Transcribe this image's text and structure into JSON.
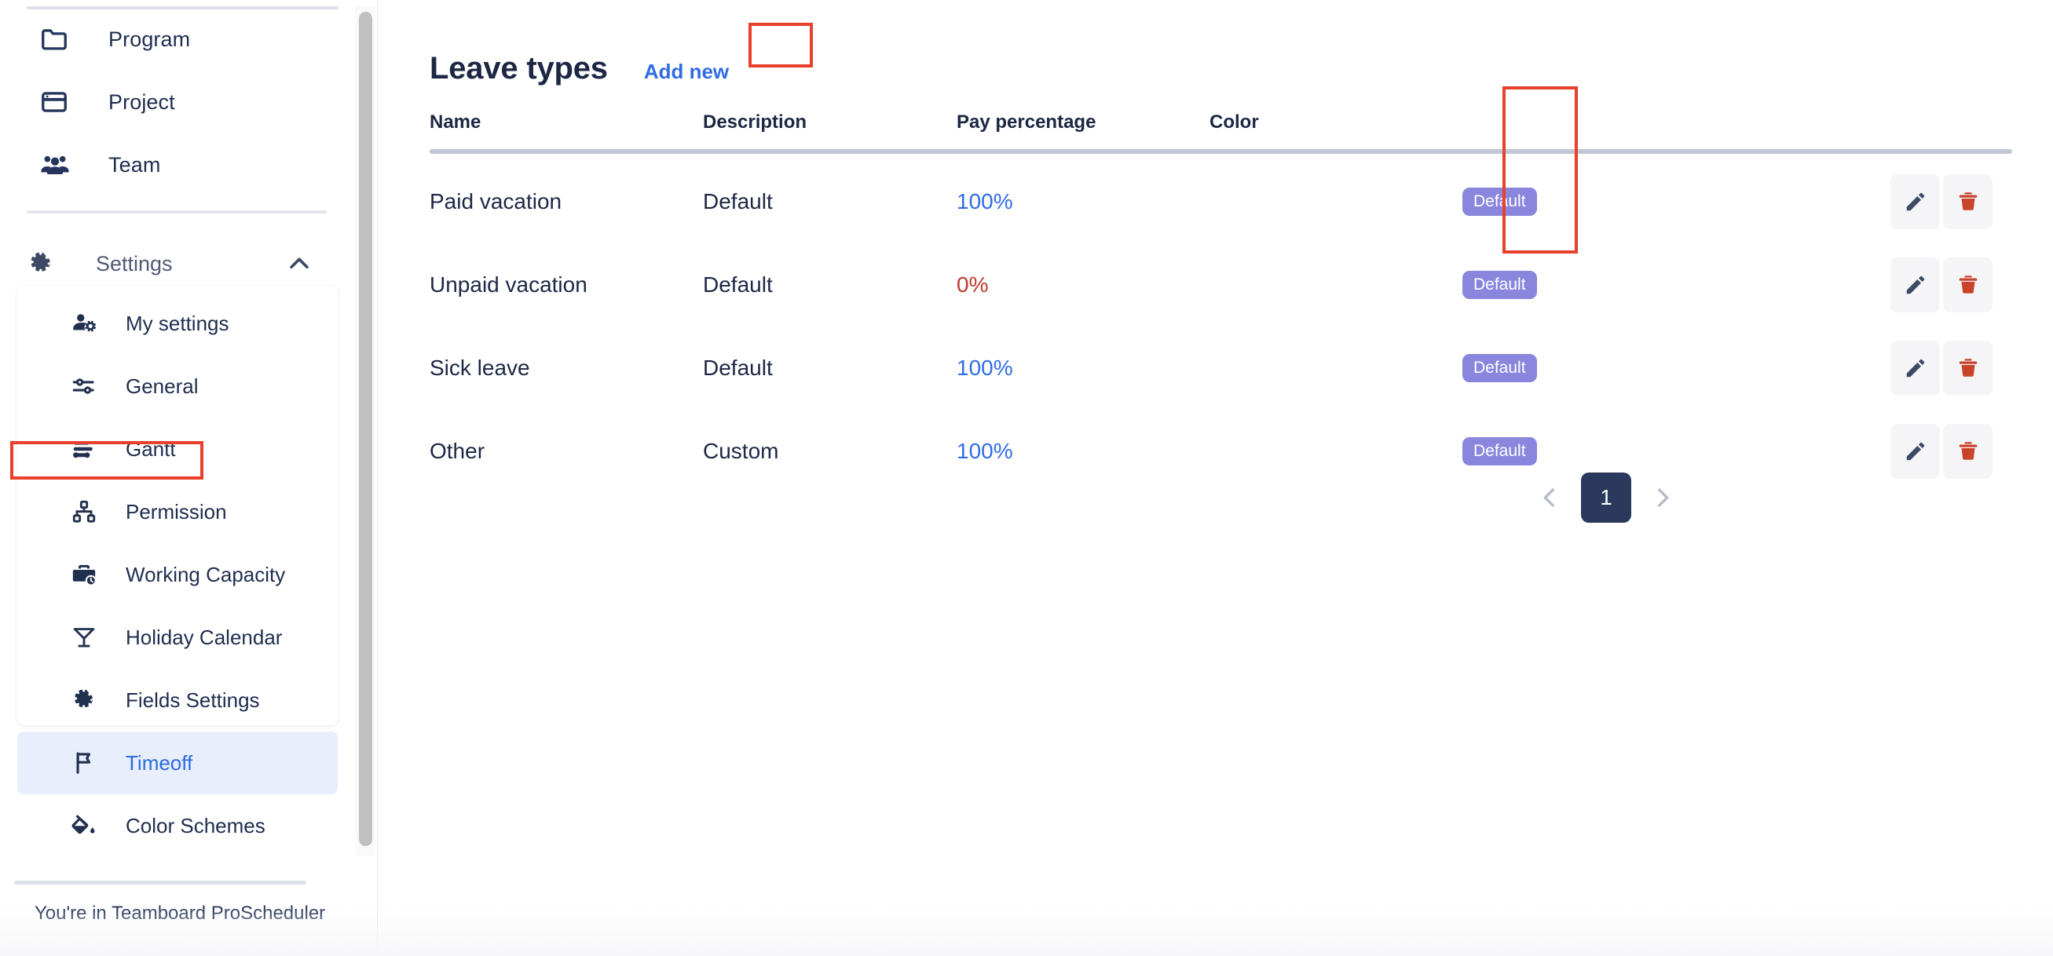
{
  "sidebar": {
    "primary_items": [
      {
        "label": "Program",
        "icon": "folder-icon"
      },
      {
        "label": "Project",
        "icon": "browser-window-icon"
      },
      {
        "label": "Team",
        "icon": "people-group-icon"
      }
    ],
    "settings_group": {
      "label": "Settings",
      "icon": "gear-icon",
      "chevron": "chevron-up-icon",
      "expanded": true,
      "items": [
        {
          "label": "My settings",
          "icon": "user-gear-icon",
          "active": false
        },
        {
          "label": "General",
          "icon": "sliders-icon",
          "active": false
        },
        {
          "label": "Gantt",
          "icon": "gantt-bars-icon",
          "active": false
        },
        {
          "label": "Permission",
          "icon": "hierarchy-icon",
          "active": false
        },
        {
          "label": "Working Capacity",
          "icon": "briefcase-clock-icon",
          "active": false
        },
        {
          "label": "Holiday Calendar",
          "icon": "cocktail-icon",
          "active": false
        },
        {
          "label": "Fields Settings",
          "icon": "gear-icon",
          "active": false
        },
        {
          "label": "Timeoff",
          "icon": "flag-icon",
          "active": true
        },
        {
          "label": "Color Schemes",
          "icon": "paint-bucket-icon",
          "active": false
        }
      ]
    },
    "footer_note": "You're in Teamboard ProScheduler"
  },
  "main": {
    "title": "Leave types",
    "add_new_label": "Add new",
    "table": {
      "columns": [
        "Name",
        "Description",
        "Pay percentage",
        "Color"
      ],
      "rows": [
        {
          "name": "Paid vacation",
          "description": "Default",
          "pay_percentage": "100%",
          "pay_state": "positive",
          "color": "#16255a",
          "badge": "Default",
          "edit_icon": "pencil-icon",
          "delete_icon": "trash-icon"
        },
        {
          "name": "Unpaid vacation",
          "description": "Default",
          "pay_percentage": "0%",
          "pay_state": "zero",
          "color": "#16255a",
          "badge": "Default",
          "edit_icon": "pencil-icon",
          "delete_icon": "trash-icon"
        },
        {
          "name": "Sick leave",
          "description": "Default",
          "pay_percentage": "100%",
          "pay_state": "positive",
          "color": "#16255a",
          "badge": "Default",
          "edit_icon": "pencil-icon",
          "delete_icon": "trash-icon"
        },
        {
          "name": "Other",
          "description": "Custom",
          "pay_percentage": "100%",
          "pay_state": "positive",
          "color": "#f0ad5a",
          "badge": "Default",
          "edit_icon": "pencil-icon",
          "delete_icon": "trash-icon"
        }
      ]
    },
    "pagination": {
      "prev_icon": "chevron-left-icon",
      "next_icon": "chevron-right-icon",
      "current_page": "1"
    }
  },
  "annotations": {
    "color": "#e8402a",
    "boxes": [
      "add-new-button",
      "row-action-buttons",
      "sidebar-item-timeoff"
    ]
  },
  "colors": {
    "accent_blue": "#2f6ce5",
    "navy": "#1c2744",
    "badge_purple": "#8a86dd",
    "danger_red": "#c0392b",
    "annotation_red": "#e8402a",
    "active_item_bg": "#e8eefc",
    "swatch_navy": "#16255a",
    "swatch_orange": "#f0ad5a",
    "pager_navy": "#2b3a5c"
  }
}
